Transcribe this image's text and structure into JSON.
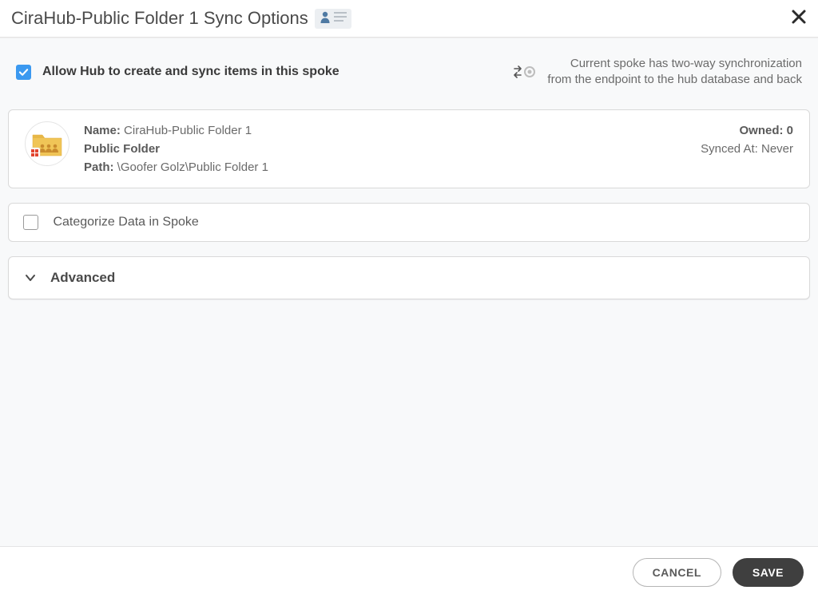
{
  "header": {
    "title": "CiraHub-Public Folder 1 Sync Options"
  },
  "sync": {
    "allow_label": "Allow Hub to create and sync items in this spoke",
    "desc_line1": "Current spoke has two-way synchronization",
    "desc_line2": "from the endpoint to the hub database and back"
  },
  "info": {
    "name_label": "Name:",
    "name_value": "CiraHub-Public Folder 1",
    "type_value": "Public Folder",
    "path_label": "Path:",
    "path_value": "\\Goofer Golz\\Public Folder 1",
    "owned_label": "Owned:",
    "owned_value": "0",
    "synced_label": "Synced At:",
    "synced_value": "Never"
  },
  "categorize": {
    "label": "Categorize Data in Spoke"
  },
  "advanced": {
    "label": "Advanced"
  },
  "footer": {
    "cancel": "CANCEL",
    "save": "SAVE"
  }
}
